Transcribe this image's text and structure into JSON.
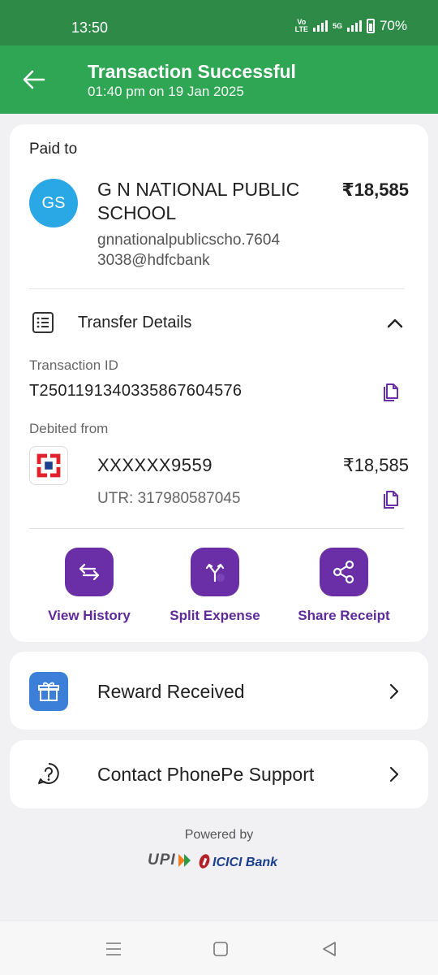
{
  "status_bar": {
    "time": "13:50",
    "network": "VoLTE",
    "network_5g": "5G",
    "battery": "70%"
  },
  "header": {
    "title": "Transaction Successful",
    "subtitle": "01:40 pm on 19 Jan 2025"
  },
  "payment": {
    "paid_to_label": "Paid to",
    "avatar_initials": "GS",
    "avatar_color": "#2aa8e6",
    "payee_name": "G N NATIONAL PUBLIC SCHOOL",
    "payee_upi": "gnnationalpublicscho.76043038@hdfcbank",
    "amount": "₹18,585"
  },
  "transfer_details": {
    "label": "Transfer Details",
    "transaction_id_label": "Transaction ID",
    "transaction_id": "T2501191340335867604576",
    "debited_from_label": "Debited from",
    "account_number": "XXXXXX9559",
    "debited_amount": "₹18,585",
    "utr": "UTR: 317980587045"
  },
  "actions": [
    {
      "label": "View History",
      "icon": "transfer-arrows-icon"
    },
    {
      "label": "Split Expense",
      "icon": "split-icon"
    },
    {
      "label": "Share Receipt",
      "icon": "share-icon"
    }
  ],
  "reward": {
    "label": "Reward Received",
    "icon": "gift-icon"
  },
  "support": {
    "label": "Contact PhonePe Support",
    "icon": "help-icon"
  },
  "footer": {
    "powered_by": "Powered by",
    "upi_logo": "UPI",
    "bank_logo": "ICICI Bank"
  },
  "colors": {
    "header_green": "#2fa653",
    "status_green": "#2e8b47",
    "accent_purple": "#6a2ea7"
  }
}
